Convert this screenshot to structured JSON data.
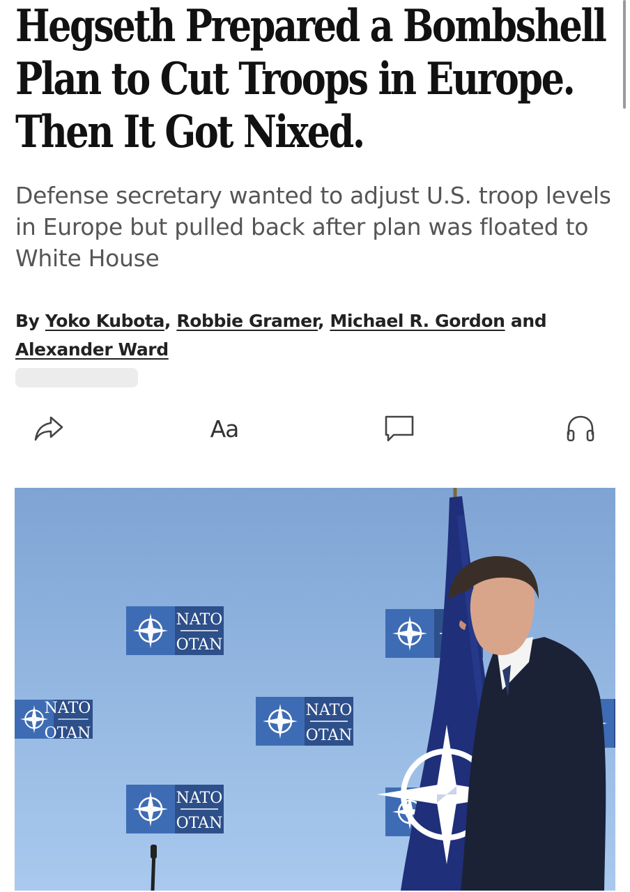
{
  "article": {
    "headline": "Hegseth Prepared a Bombshell\nPlan to Cut Troops in Europe.\nThen It Got Nixed.",
    "dek": "Defense secretary wanted to adjust U.S. troop levels in Europe but pulled back after plan was floated to White House",
    "byline": {
      "prefix": "By",
      "authors": [
        "Yoko Kubota",
        "Robbie Gramer",
        "Michael R. Gordon",
        "Alexander Ward"
      ],
      "sep1": ",",
      "sep2": ",",
      "conjunction": "and"
    }
  },
  "toolbar": {
    "share_icon": "share-arrow-icon",
    "text_size_label": "Aa",
    "comments_icon": "comment-bubble-icon",
    "listen_icon": "headphones-icon"
  },
  "hero_image": {
    "logo_text_top": "NATO",
    "logo_text_bottom": "OTAN",
    "colors": {
      "backdrop": "#8fb2dd",
      "flag": "#1f2f7a",
      "suit": "#1b2236"
    }
  }
}
